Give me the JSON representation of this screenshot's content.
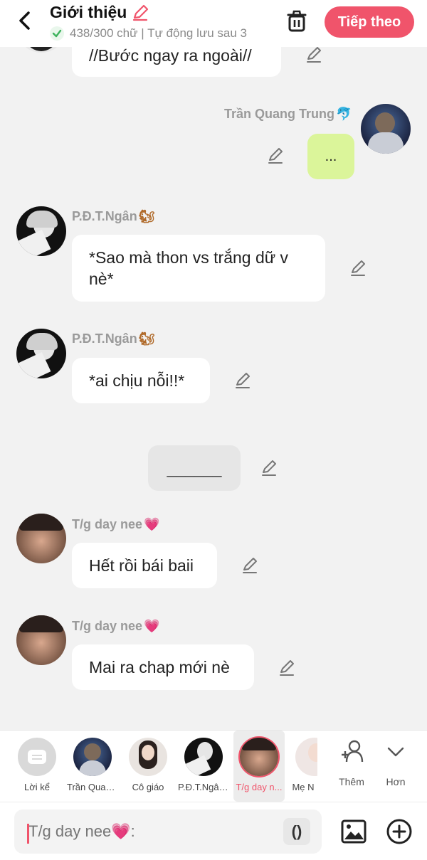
{
  "header": {
    "title": "Giới thiệu",
    "status": "438/300 chữ | Tự động lưu sau 3",
    "next_label": "Tiếp theo"
  },
  "chat": {
    "msg0_text": "//Bước ngay ra ngoài//",
    "msg1_name": "Trần Quang Trung",
    "msg1_text": "...",
    "msg2_name": "P.Đ.T.Ngân",
    "msg2_text_line1": "*Sao mà thon vs trắng dữ v",
    "msg2_text_line2": "nè*",
    "msg3_name": "P.Đ.T.Ngân",
    "msg3_text": "*ai chịu nỗi!!*",
    "msg4_text": "______",
    "msg5_name": "T/g day nee",
    "msg5_text": "Hết rồi bái baii",
    "msg6_name": "T/g day nee",
    "msg6_text": "Mai ra chap mới nè"
  },
  "characters": [
    {
      "label": "Lời kể"
    },
    {
      "label": "Trần Quan..."
    },
    {
      "label": "Cô giáo"
    },
    {
      "label": "P.Đ.T.Ngân..."
    },
    {
      "label": "T/g day n..."
    },
    {
      "label": "Mẹ N"
    }
  ],
  "utils": {
    "add_label": "Thêm",
    "more_label": "Hơn"
  },
  "input": {
    "placeholder": "T/g day nee💗:",
    "paren": "()"
  },
  "colors": {
    "accent": "#f0546b",
    "own_bubble": "#dbf59a",
    "background": "#f2f2f2"
  },
  "icons": {
    "back": "chevron-left-icon",
    "trash": "trash-icon",
    "edit": "pencil-icon",
    "image": "image-icon",
    "add": "plus-circle-icon"
  }
}
